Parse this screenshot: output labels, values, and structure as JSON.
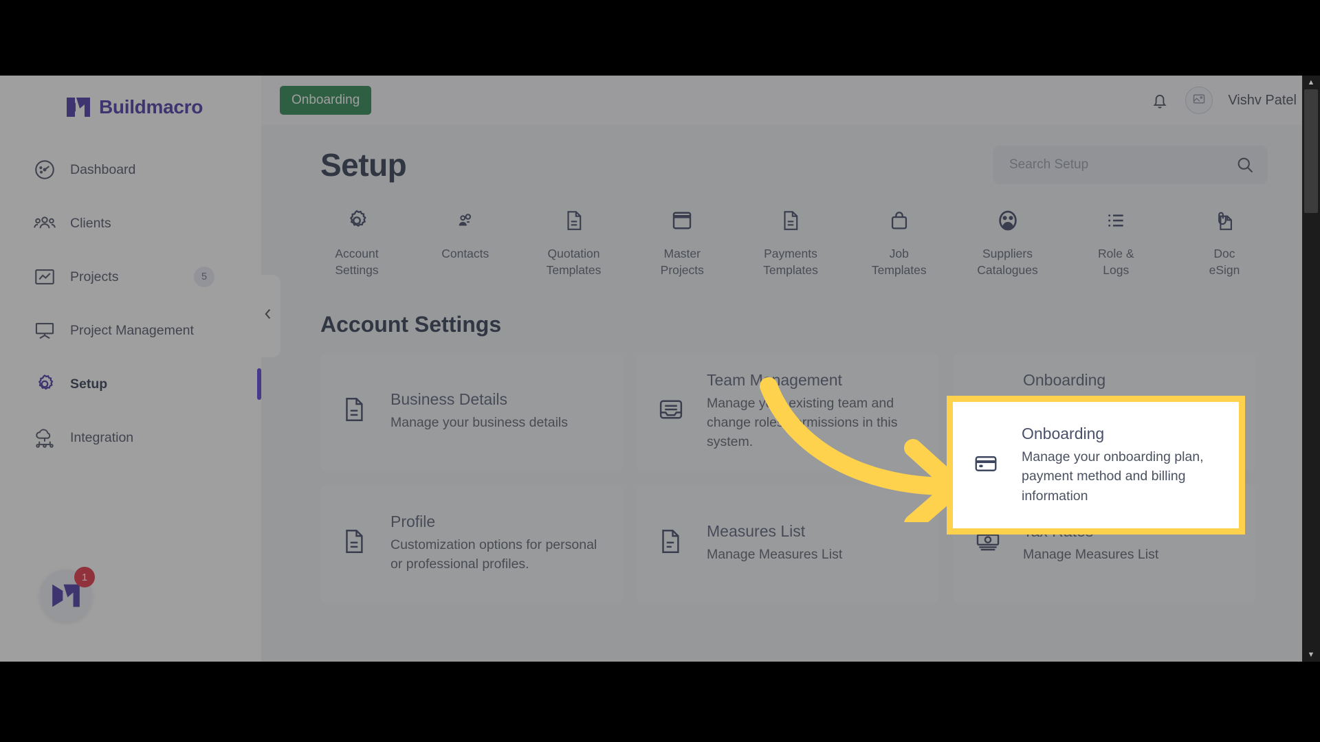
{
  "app": {
    "brand_name": "Buildmacro",
    "logo_icon": "buildmacro-m-logo"
  },
  "sidebar": {
    "items": [
      {
        "label": "Dashboard",
        "icon": "gauge-icon",
        "badge": "",
        "active": false
      },
      {
        "label": "Clients",
        "icon": "people-group-icon",
        "badge": "",
        "active": false
      },
      {
        "label": "Projects",
        "icon": "chart-box-icon",
        "badge": "5",
        "active": false
      },
      {
        "label": "Project Management",
        "icon": "easel-board-icon",
        "badge": "",
        "active": false
      },
      {
        "label": "Setup",
        "icon": "gear-icon",
        "badge": "",
        "active": true
      },
      {
        "label": "Integration",
        "icon": "cloud-network-icon",
        "badge": "",
        "active": false
      }
    ],
    "collapse_icon": "chevron-left-icon",
    "float_badge_count": "1"
  },
  "topbar": {
    "onboarding_chip": "Onboarding",
    "bell_icon": "bell-icon",
    "avatar_icon": "image-placeholder-icon",
    "username": "Vishv Patel"
  },
  "page": {
    "title": "Setup",
    "search_placeholder": "Search Setup",
    "search_value": "",
    "search_icon": "search-icon"
  },
  "quick_links": [
    {
      "label_lines": [
        "Account",
        "Settings"
      ],
      "icon": "gear-icon"
    },
    {
      "label_lines": [
        "Contacts"
      ],
      "icon": "contacts-icon"
    },
    {
      "label_lines": [
        "Quotation",
        "Templates"
      ],
      "icon": "document-lines-icon"
    },
    {
      "label_lines": [
        "Master",
        "Projects"
      ],
      "icon": "window-icon"
    },
    {
      "label_lines": [
        "Payments",
        "Templates"
      ],
      "icon": "document-lines-icon"
    },
    {
      "label_lines": [
        "Job",
        "Templates"
      ],
      "icon": "bag-icon"
    },
    {
      "label_lines": [
        "Suppliers",
        "Catalogues"
      ],
      "icon": "supplier-people-icon"
    },
    {
      "label_lines": [
        "Role &",
        "Logs"
      ],
      "icon": "list-icon"
    },
    {
      "label_lines": [
        "Doc",
        "eSign"
      ],
      "icon": "doc-clip-icon"
    }
  ],
  "section": {
    "heading": "Account Settings",
    "cards": [
      {
        "title": "Business Details",
        "desc": "Manage your business details",
        "icon": "document-lines-icon"
      },
      {
        "title": "Team Management",
        "desc": "Manage your existing team and change roles/permissions in this system.",
        "icon": "inbox-tray-icon"
      },
      {
        "title": "Onboarding",
        "desc": "Manage your onboarding plan, payment method and billing information",
        "icon": "credit-card-icon",
        "highlighted": true
      },
      {
        "title": "Profile",
        "desc": "Customization options for personal or professional profiles.",
        "icon": "document-lines-icon"
      },
      {
        "title": "Measures List",
        "desc": "Manage Measures List",
        "icon": "document-lines-icon"
      },
      {
        "title": "Tax Rates",
        "desc": "Manage Measures List",
        "icon": "banknote-icon"
      }
    ]
  },
  "annotation": {
    "arrow_color": "#ffd24d",
    "highlight_border_color": "#ffd24d",
    "points_to": "Onboarding"
  },
  "colors": {
    "brand_purple": "#35209c",
    "accent_purple": "#4d2bd6",
    "chip_green": "#147a3d",
    "badge_red": "#e01b2e",
    "text_dark": "#1b2440",
    "text_muted": "#4b5160",
    "page_bg": "#eef0f5",
    "card_bg": "#f3f4f8"
  },
  "scrollbar": {
    "up_arrow": "▲",
    "down_arrow": "▼"
  }
}
